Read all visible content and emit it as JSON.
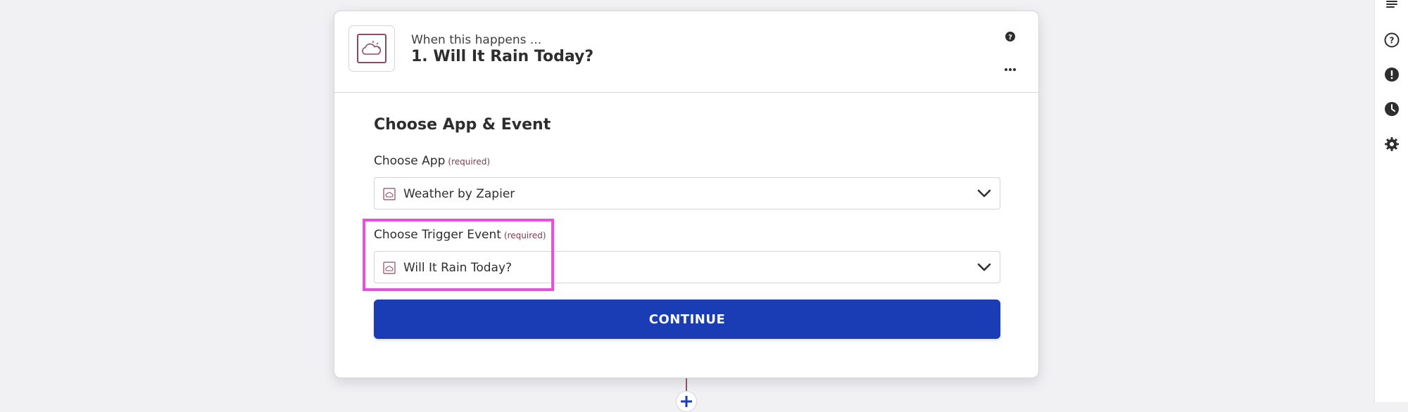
{
  "step": {
    "kicker": "When this happens ...",
    "title": "1. Will It Rain Today?",
    "app_icon": "weather-cloud-icon"
  },
  "form": {
    "section_title": "Choose App & Event",
    "app_field": {
      "label": "Choose App",
      "required_note": "(required)",
      "value": "Weather by Zapier"
    },
    "trigger_field": {
      "label": "Choose Trigger Event",
      "required_note": "(required)",
      "value": "Will It Rain Today?"
    },
    "continue_label": "CONTINUE"
  },
  "header_actions": [
    "help-icon",
    "more-options-icon"
  ],
  "sidebar": {
    "items": [
      "details-icon",
      "help-icon",
      "alert-icon",
      "history-icon",
      "settings-icon"
    ]
  },
  "colors": {
    "primary_button": "#1a3cb5",
    "highlight": "#e84ee0",
    "background": "#f1f1f4",
    "required_text": "#7a3b52"
  }
}
